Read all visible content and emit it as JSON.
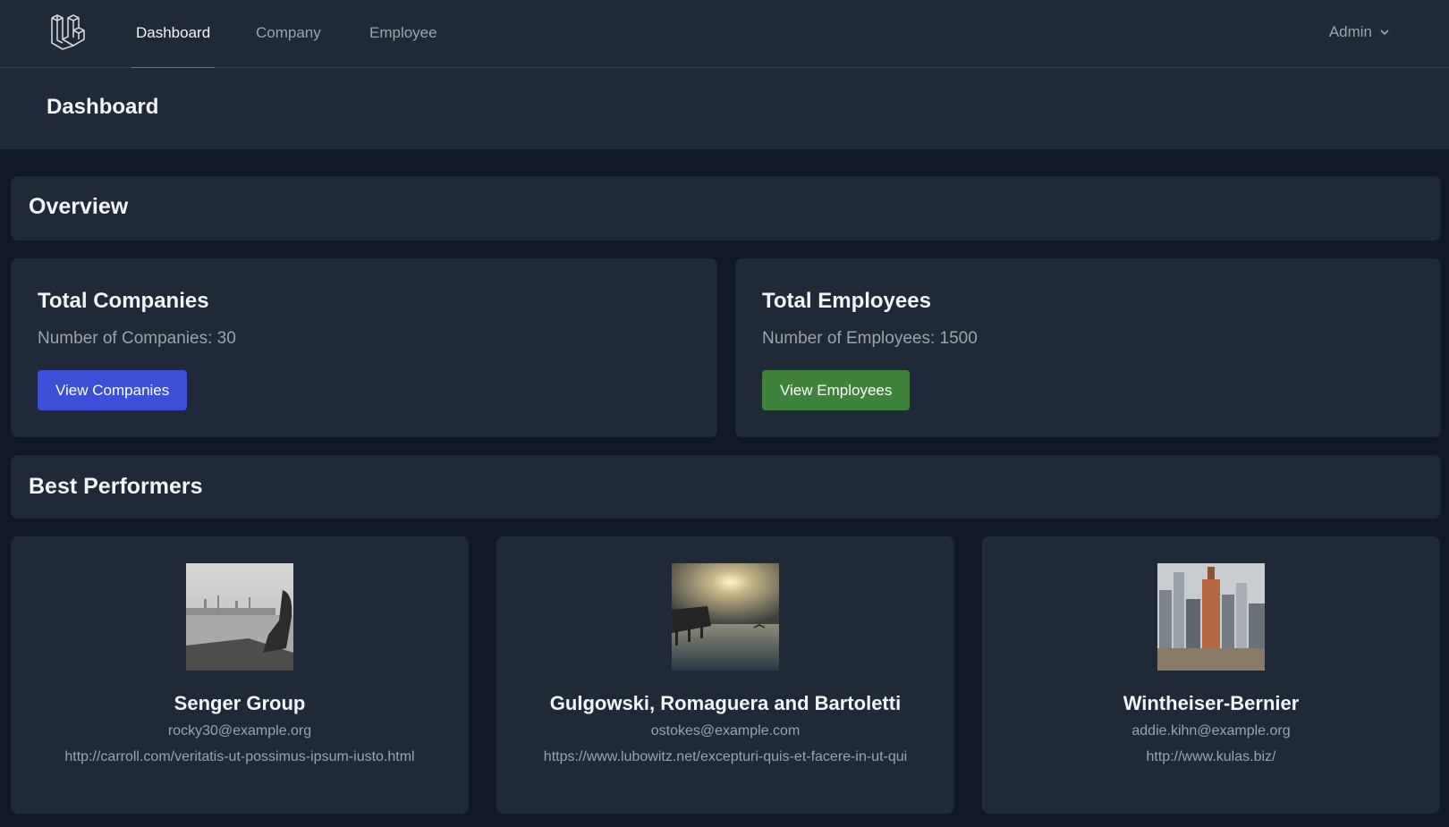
{
  "nav": {
    "links": [
      "Dashboard",
      "Company",
      "Employee"
    ],
    "active": "Dashboard",
    "user": "Admin",
    "accent_color": "#6366f1"
  },
  "header": {
    "title": "Dashboard"
  },
  "overview": {
    "title": "Overview",
    "companies": {
      "title": "Total Companies",
      "text": "Number of Companies: 30",
      "button": "View Companies",
      "button_color": "#3b4fd8"
    },
    "employees": {
      "title": "Total Employees",
      "text": "Number of Employees: 1500",
      "button": "View Employees",
      "button_color": "#3f823c"
    }
  },
  "best_performers": {
    "title": "Best Performers",
    "items": [
      {
        "name": "Senger Group",
        "email": "rocky30@example.org",
        "url": "http://carroll.com/veritatis-ut-possimus-ipsum-iusto.html",
        "image": "city-skyline-water-photo"
      },
      {
        "name": "Gulgowski, Romaguera and Bartoletti",
        "email": "ostokes@example.com",
        "url": "https://www.lubowitz.net/excepturi-quis-et-facere-in-ut-qui",
        "image": "sunset-pier-sea-photo"
      },
      {
        "name": "Wintheiser-Bernier",
        "email": "addie.kihn@example.org",
        "url": "http://www.kulas.biz/",
        "image": "city-buildings-aerial-photo"
      }
    ]
  }
}
